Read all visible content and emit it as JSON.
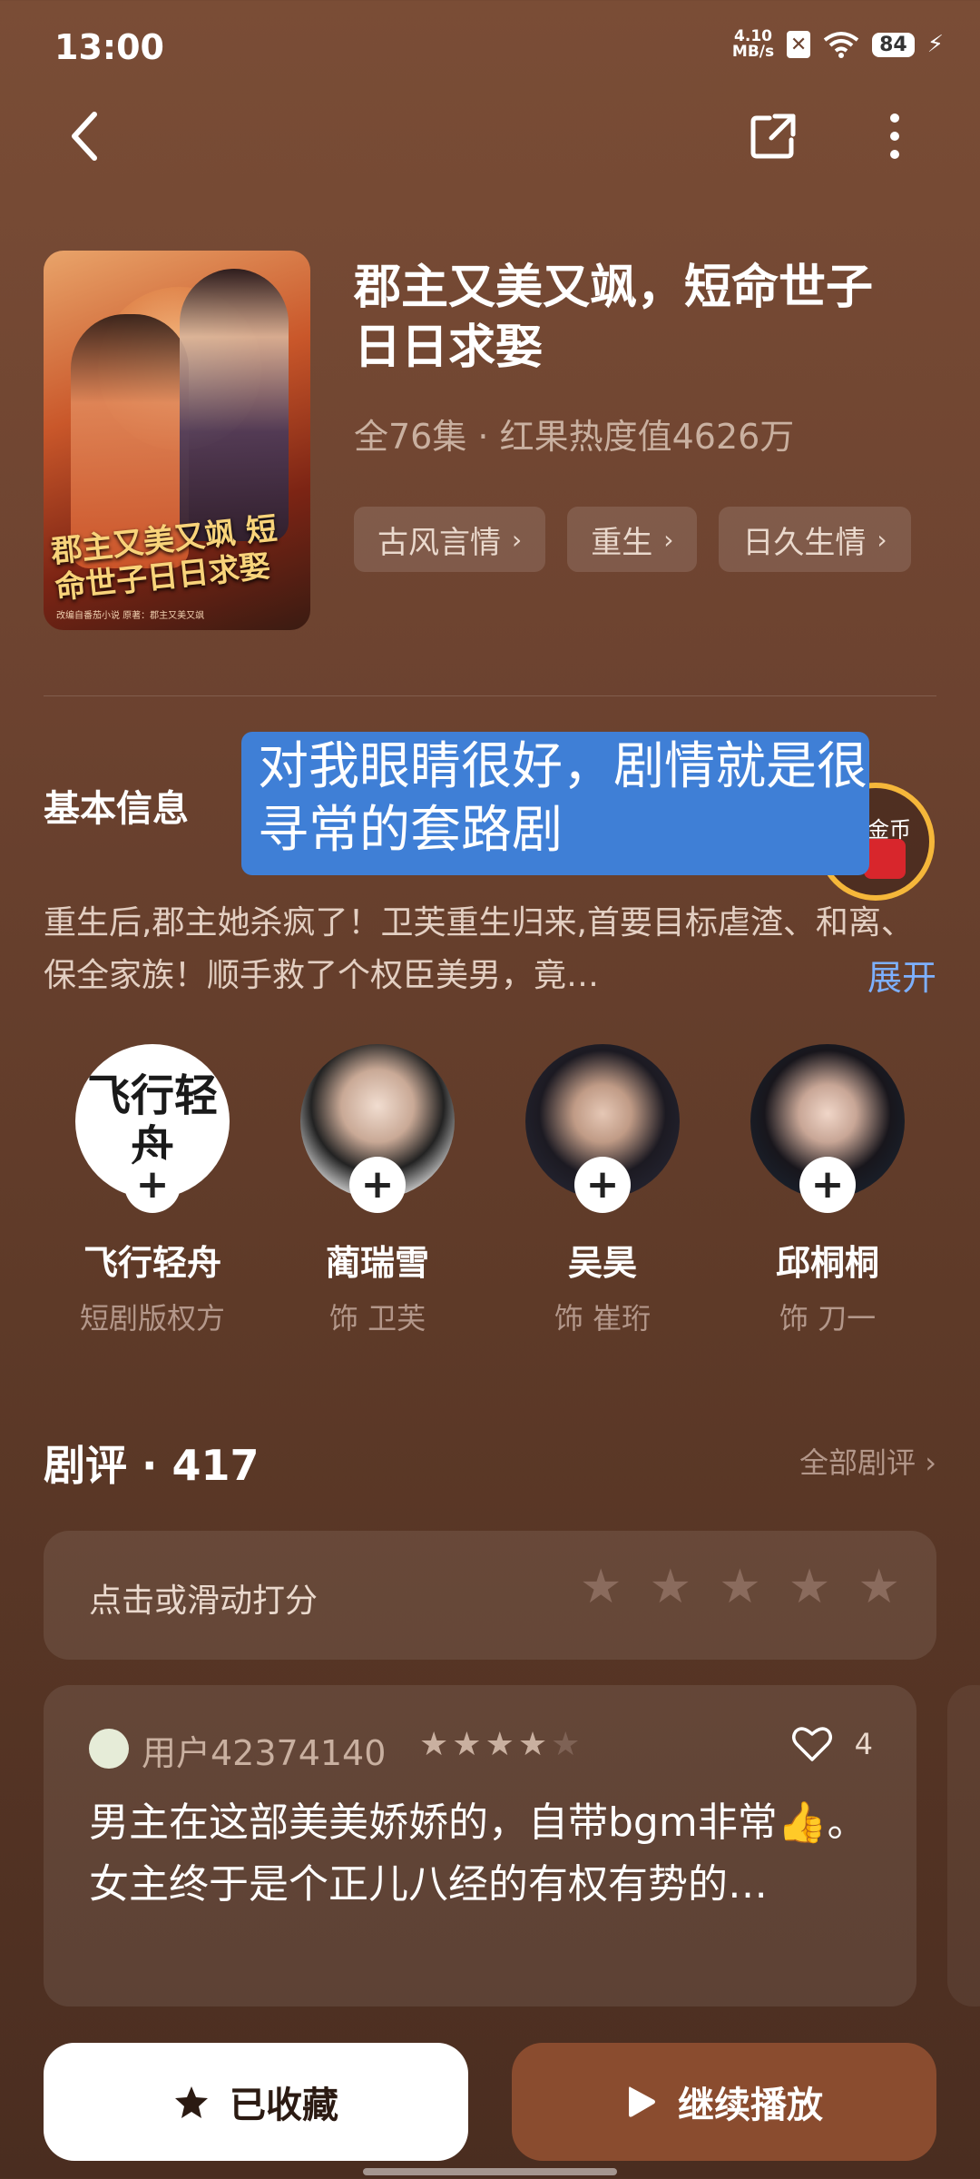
{
  "status_bar": {
    "time": "13:00",
    "net_speed_top": "4.10",
    "net_speed_unit": "MB/s",
    "sim": "✕",
    "battery": "84",
    "charging": "⚡"
  },
  "nav": {
    "back_icon": "chevron-left-icon",
    "share_icon": "share-icon",
    "more_icon": "more-vertical-icon"
  },
  "drama": {
    "poster_title": "郡主又美又飒 短命世子日日求娶",
    "poster_caption": "改编自番茄小说 原著：郡主又美又飒",
    "title": "郡主又美又飒，短命世子日日求娶",
    "meta": "全76集 · 红果热度值4626万",
    "tags": [
      "古风言情",
      "重生",
      "日久生情"
    ]
  },
  "basic_info": {
    "title": "基本信息",
    "overlay_comment": "对我眼睛很好，剧情就是很寻常的套路剧",
    "coin_label": "金币",
    "description": "重生后,郡主她杀疯了！卫芙重生归来,首要目标虐渣、和离、保全家族！顺手救了个权臣美男，竟…",
    "expand": "展开"
  },
  "cast": [
    {
      "logo": "飞行轻舟",
      "name": "飞行轻舟",
      "role": "短剧版权方",
      "plus": "+"
    },
    {
      "name": "蔺瑞雪",
      "role": "饰 卫芙",
      "plus": "+"
    },
    {
      "name": "吴昊",
      "role": "饰 崔珩",
      "plus": "+"
    },
    {
      "name": "邱桐桐",
      "role": "饰 刀一",
      "plus": "+"
    }
  ],
  "reviews": {
    "header": "剧评 · 417",
    "all_link": "全部剧评",
    "rate_prompt": "点击或滑动打分",
    "rate_stars": 5,
    "items": [
      {
        "user": "用户42374140",
        "rating": 4,
        "likes": "4",
        "text": "男主在这部美美娇娇的，自带bgm非常👍。\n女主终于是个正儿八经的有权有势的…"
      }
    ]
  },
  "bottom": {
    "fav_label": "已收藏",
    "play_label": "继续播放"
  },
  "colors": {
    "background": "#6d4330",
    "accent_link": "#7db0ff",
    "play_button": "#8a4c2f",
    "overlay": "#3f7fd6"
  }
}
